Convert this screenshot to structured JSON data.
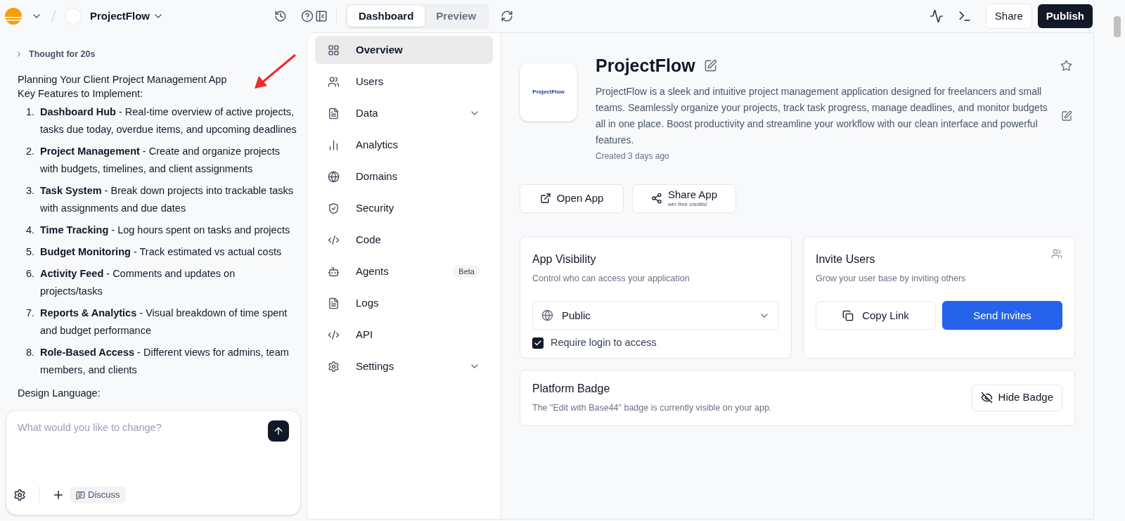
{
  "topbar": {
    "project_name": "ProjectFlow",
    "view_tabs": [
      {
        "label": "Dashboard",
        "selected": true
      },
      {
        "label": "Preview",
        "selected": false
      }
    ],
    "share": "Share",
    "publish": "Publish"
  },
  "chat": {
    "thought": "Thought for 20s",
    "heading": "Planning Your Client Project Management App",
    "subheading": "Key Features to Implement:",
    "features": [
      {
        "number": "1.",
        "text": "**Dashboard Hub** - Real-time overview of active projects, tasks due today, overdue items, and upcoming deadlines"
      },
      {
        "number": "2.",
        "text": "**Project Management** - Create and organize projects with budgets, timelines, and client assignments"
      },
      {
        "number": "3.",
        "text": "**Task System** - Break down projects into trackable tasks with assignments and due dates"
      },
      {
        "number": "4.",
        "text": "**Time Tracking** - Log hours spent on tasks and projects"
      },
      {
        "number": "5.",
        "text": "**Budget Monitoring** - Track estimated vs actual costs"
      },
      {
        "number": "6.",
        "text": "**Activity Feed** - Comments and updates on projects/tasks"
      },
      {
        "number": "7.",
        "text": "**Reports & Analytics** - Visual breakdown of time spent and budget performance"
      },
      {
        "number": "8.",
        "text": "**Role-Based Access** - Different views for admins, team members, and clients"
      }
    ],
    "trailing": "Design Language:",
    "input_placeholder": "What would you like to change?",
    "discuss": "Discuss"
  },
  "nav": [
    {
      "label": "Overview",
      "selected": true
    },
    {
      "label": "Users",
      "selected": false
    },
    {
      "label": "Data",
      "selected": false,
      "expandable": true
    },
    {
      "label": "Analytics",
      "selected": false
    },
    {
      "label": "Domains",
      "selected": false
    },
    {
      "label": "Security",
      "selected": false
    },
    {
      "label": "Code",
      "selected": false
    },
    {
      "label": "Agents",
      "selected": false,
      "badge": "Beta"
    },
    {
      "label": "Logs",
      "selected": false
    },
    {
      "label": "API",
      "selected": false
    },
    {
      "label": "Settings",
      "selected": false,
      "expandable": true
    }
  ],
  "app": {
    "logo_text": "ProjectFlow",
    "name": "ProjectFlow",
    "description": "ProjectFlow is a sleek and intuitive project management application designed for freelancers and small teams. Seamlessly organize your projects, track task progress, manage deadlines, and monitor budgets all in one place. Boost productivity and streamline your workflow with our clean interface and powerful features.",
    "created": "Created 3 days ago",
    "open_app": "Open App",
    "share_app": "Share App",
    "share_app_sub": "win free credits!"
  },
  "visibility": {
    "title": "App Visibility",
    "subtitle": "Control who can access your application",
    "value": "Public",
    "require_login": {
      "label": "Require login to access",
      "checked": true
    }
  },
  "invite": {
    "title": "Invite Users",
    "subtitle": "Grow your user base by inviting others",
    "copy_link": "Copy Link",
    "send_invites": "Send Invites"
  },
  "badge": {
    "title": "Platform Badge",
    "subtitle": "The \"Edit with Base44\" badge is currently visible on your app.",
    "hide": "Hide Badge"
  }
}
